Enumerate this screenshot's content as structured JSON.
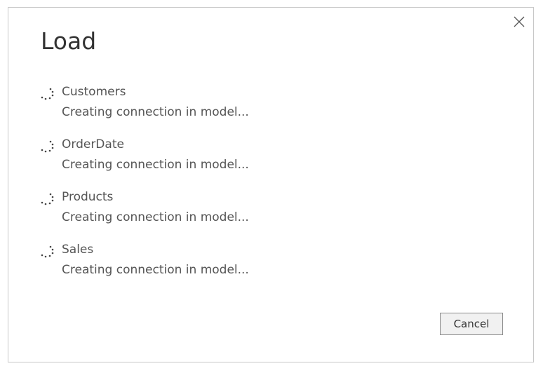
{
  "dialog": {
    "title": "Load",
    "close_icon": "close-icon",
    "items": [
      {
        "name": "Customers",
        "status": "Creating connection in model..."
      },
      {
        "name": "OrderDate",
        "status": "Creating connection in model..."
      },
      {
        "name": "Products",
        "status": "Creating connection in model..."
      },
      {
        "name": "Sales",
        "status": "Creating connection in model..."
      }
    ],
    "cancel_label": "Cancel"
  }
}
